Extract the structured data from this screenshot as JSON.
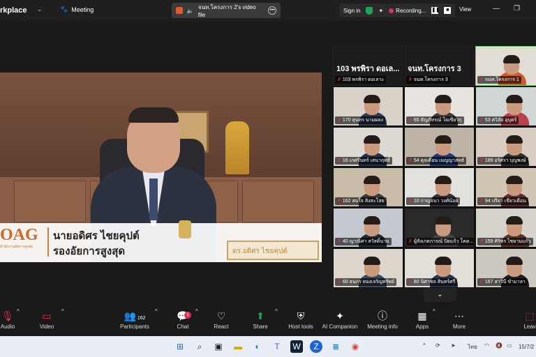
{
  "app": {
    "brand": "rkplace",
    "meeting_label": "Meeting",
    "share_title": "จนท.โครงการ 2's video file",
    "signin": "Sign in",
    "recording": "Recording...",
    "view": "View"
  },
  "presenter": {
    "logo": "OAG",
    "logo_sub": "สำนักงานอัยการสูงสุด",
    "name_line1": "นายอดิศร ไชยคุปต์",
    "name_line2": "รองอัยการสูงสุด",
    "nameplate": "ดร.อดิศร ไชยคุปต์"
  },
  "gallery": {
    "speaker_tiles": [
      {
        "big": "103 พรพิรา ดอเล...",
        "label": "103 พรพิรา ดอเลาะ"
      },
      {
        "big": "จนท.โครงการ 3",
        "label": "จนท.โครงการ 3"
      },
      {
        "big": "",
        "label": "จนท.โครงการ 1"
      }
    ],
    "tiles": [
      {
        "label": "170 สุนทร นามผลง"
      },
      {
        "label": "65 ธัญภัทรณ์ โยเขียวกุ"
      },
      {
        "label": "53 ศวิลัย อุบุตร์"
      },
      {
        "label": "16 เกศรินทร์ เสนาฤทธิ์"
      },
      {
        "label": "54 ดุจเดือน เมญญาสทธ์"
      },
      {
        "label": "189 อริศรา บุญพงษ์"
      },
      {
        "label": "162 สมใจ สิงสะโสย"
      },
      {
        "label": "10 กาญจนา วงศ์น้อย"
      },
      {
        "label": "94 ปรียา เขียวเดือน"
      },
      {
        "label": "40 ญาณิศา สวัสดิ์นาม"
      },
      {
        "label": "ผู้สังเกตการณ์ ปิยแก้ว โคต..."
      },
      {
        "label": "159 ศิริพร ไชยามแก้ว"
      },
      {
        "label": "60 ธนกร ทองเจริญทรัพย์"
      },
      {
        "label": "80 นิศาชล สินทร์ศรี"
      },
      {
        "label": "167 สาวินี ขำมาลา"
      }
    ]
  },
  "toolbar": {
    "audio": "Audio",
    "video": "Video",
    "participants": "Participants",
    "participants_count": "162",
    "chat": "Chat",
    "chat_badge": "1",
    "react": "React",
    "share": "Share",
    "host_tools": "Host tools",
    "ai_companion": "AI Companion",
    "meeting_info": "Meeting info",
    "apps": "Apps",
    "more": "More",
    "leave": "Leav"
  },
  "taskbar": {
    "lang": "ไทย",
    "date": "15/7/2"
  },
  "colors": {
    "record_red": "#e0314b",
    "active_green": "#6bd66b",
    "share_green": "#21a35b"
  }
}
